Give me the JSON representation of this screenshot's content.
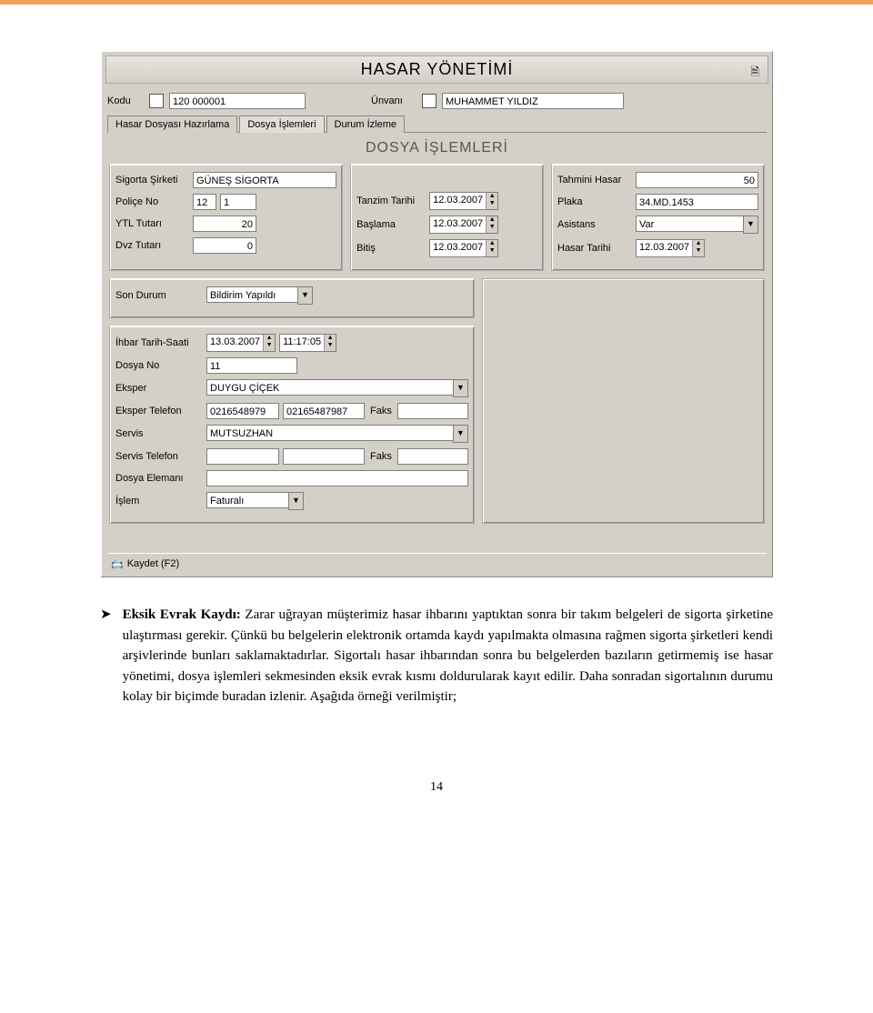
{
  "window": {
    "title": "HASAR YÖNETİMİ"
  },
  "header": {
    "kodu_label": "Kodu",
    "kodu_value": "120 000001",
    "unvani_label": "Ünvanı",
    "unvani_value": "MUHAMMET YILDIZ"
  },
  "tabs": {
    "t1": "Hasar Dosyası Hazırlama",
    "t2": "Dosya İşlemleri",
    "t3": "Durum İzleme"
  },
  "panel_title": "DOSYA İŞLEMLERİ",
  "left_group": {
    "sigorta_sirketi_label": "Sigorta Şirketi",
    "sigorta_sirketi_value": "GÜNEŞ SİGORTA",
    "police_no_label": "Poliçe No",
    "police_no_v1": "12",
    "police_no_v2": "1",
    "ytl_tutari_label": "YTL  Tutarı",
    "ytl_tutari_value": "20",
    "dvz_tutari_label": "Dvz Tutarı",
    "dvz_tutari_value": "0"
  },
  "mid_group": {
    "tanzim_tarihi_label": "Tanzim Tarihi",
    "tanzim_tarihi_value": "12.03.2007",
    "baslama_label": "Başlama",
    "baslama_value": "12.03.2007",
    "bitis_label": "Bitiş",
    "bitis_value": "12.03.2007"
  },
  "right_group": {
    "tahmini_hasar_label": "Tahmini Hasar",
    "tahmini_hasar_value": "50",
    "plaka_label": "Plaka",
    "plaka_value": "34.MD.1453",
    "asistans_label": "Asistans",
    "asistans_value": "Var",
    "hasar_tarihi_label": "Hasar Tarihi",
    "hasar_tarihi_value": "12.03.2007"
  },
  "status": {
    "son_durum_label": "Son Durum",
    "son_durum_value": "Bildirim Yapıldı"
  },
  "details": {
    "ihbar_label": "İhbar Tarih-Saati",
    "ihbar_date": "13.03.2007",
    "ihbar_time": "11:17:05",
    "dosya_no_label": "Dosya No",
    "dosya_no_value": "11",
    "eksper_label": "Eksper",
    "eksper_value": "DUYGU ÇİÇEK",
    "eksper_tel_label": "Eksper Telefon",
    "eksper_tel1": "0216548979",
    "eksper_tel2": "02165487987",
    "faks_label": "Faks",
    "servis_label": "Servis",
    "servis_value": "MUTSUZHAN",
    "servis_tel_label": "Servis Telefon",
    "dosya_elemani_label": "Dosya Elemanı",
    "islem_label": "İşlem",
    "islem_value": "Faturalı"
  },
  "bottom": {
    "kaydet_label": "Kaydet (F2)"
  },
  "article": {
    "heading": "Eksik Evrak Kaydı:",
    "body": "Zarar uğrayan müşterimiz hasar ihbarını yaptıktan sonra bir takım belgeleri de sigorta şirketine ulaştırması gerekir. Çünkü bu belgelerin elektronik ortamda kaydı yapılmakta olmasına rağmen sigorta şirketleri kendi arşivlerinde bunları saklamaktadırlar. Sigortalı hasar ihbarından sonra bu belgelerden bazıların getirmemiş ise hasar yönetimi, dosya işlemleri sekmesinden eksik evrak kısmı doldurularak kayıt edilir. Daha sonradan sigortalının durumu kolay bir biçimde buradan izlenir. Aşağıda örneği verilmiştir;"
  },
  "page_number": "14"
}
